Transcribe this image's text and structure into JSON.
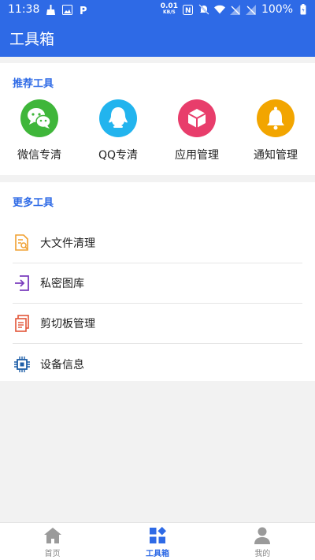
{
  "status_bar": {
    "time": "11:38",
    "net_speed_value": "0.01",
    "net_speed_unit": "KB/S",
    "battery": "100%"
  },
  "app_bar": {
    "title": "工具箱"
  },
  "recommend": {
    "title": "推荐工具",
    "items": [
      {
        "label": "微信专清",
        "icon": "wechat-icon",
        "color": "#3fb63a"
      },
      {
        "label": "QQ专清",
        "icon": "qq-icon",
        "color": "#22b4ee"
      },
      {
        "label": "应用管理",
        "icon": "app-box-icon",
        "color": "#e83d6b"
      },
      {
        "label": "通知管理",
        "icon": "bell-icon",
        "color": "#f2a500"
      }
    ]
  },
  "more_tools": {
    "title": "更多工具",
    "items": [
      {
        "label": "大文件清理",
        "icon": "file-search-icon",
        "color": "#f0a030"
      },
      {
        "label": "私密图库",
        "icon": "login-arrow-icon",
        "color": "#7a3dbd"
      },
      {
        "label": "剪切板管理",
        "icon": "clipboard-icon",
        "color": "#e25538"
      },
      {
        "label": "设备信息",
        "icon": "chip-icon",
        "color": "#1f5fa8"
      }
    ]
  },
  "bottom_nav": {
    "items": [
      {
        "label": "首页",
        "icon": "home-icon",
        "active": false
      },
      {
        "label": "工具箱",
        "icon": "toolbox-icon",
        "active": true
      },
      {
        "label": "我的",
        "icon": "person-icon",
        "active": false
      }
    ]
  },
  "colors": {
    "primary": "#2e6ae6",
    "background": "#f2f2f2",
    "inactive": "#999999"
  }
}
